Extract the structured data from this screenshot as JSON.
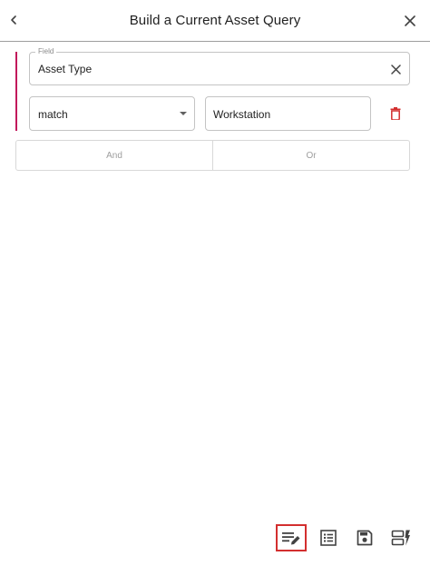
{
  "header": {
    "title": "Build a Current Asset Query",
    "back_icon": "chevron-left-icon",
    "close_icon": "close-icon"
  },
  "condition": {
    "field": {
      "legend": "Field",
      "value": "Asset Type",
      "clear_icon": "close-icon"
    },
    "operator": {
      "selected": "match",
      "arrow_icon": "dropdown-arrow-icon"
    },
    "value": {
      "current": "Workstation"
    },
    "delete_icon": "trash-icon",
    "accent_color": "#c2185b",
    "delete_color": "#d32f2f"
  },
  "logic": {
    "and_label": "And",
    "or_label": "Or"
  },
  "toolbar": {
    "items": [
      {
        "icon": "edit-query-icon",
        "selected": true
      },
      {
        "icon": "list-icon",
        "selected": false
      },
      {
        "icon": "save-icon",
        "selected": false
      },
      {
        "icon": "run-query-icon",
        "selected": false
      }
    ],
    "selected_border_color": "#d32f2f"
  }
}
